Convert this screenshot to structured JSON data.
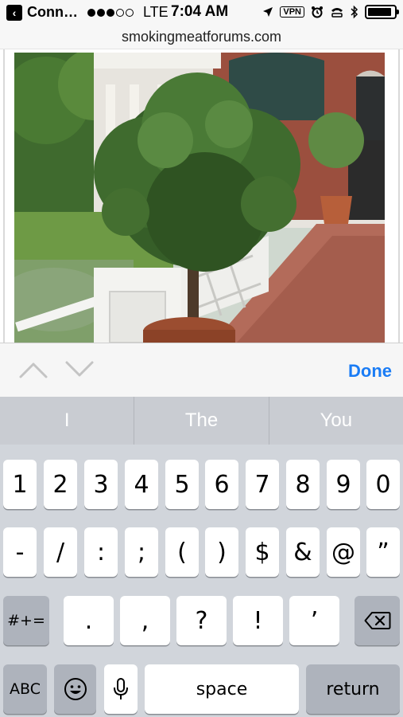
{
  "status_bar": {
    "carrier": "Conn…",
    "network": "LTE",
    "time": "7:04 AM",
    "vpn": "VPN",
    "signal_dots_filled": 3,
    "signal_dots_total": 5,
    "battery_level": 0.9
  },
  "url_bar": {
    "domain": "smokingmeatforums.com"
  },
  "web_content": {
    "image_subject": "potted tree on wooden deck"
  },
  "accessory_bar": {
    "done_label": "Done"
  },
  "predictive": [
    "I",
    "The",
    "You"
  ],
  "keyboard": {
    "row1": [
      "1",
      "2",
      "3",
      "4",
      "5",
      "6",
      "7",
      "8",
      "9",
      "0"
    ],
    "row2": [
      "-",
      "/",
      ":",
      ";",
      "(",
      ")",
      "$",
      "&",
      "@",
      "”"
    ],
    "row3_symbols": [
      "#+=",
      ".",
      ",",
      "?",
      "!",
      "’"
    ],
    "abc_label": "ABC",
    "space_label": "space",
    "return_label": "return"
  },
  "colors": {
    "accent": "#1a7cf5",
    "keyboard_bg": "#d1d5db",
    "dark_key": "#aeb3bc"
  }
}
